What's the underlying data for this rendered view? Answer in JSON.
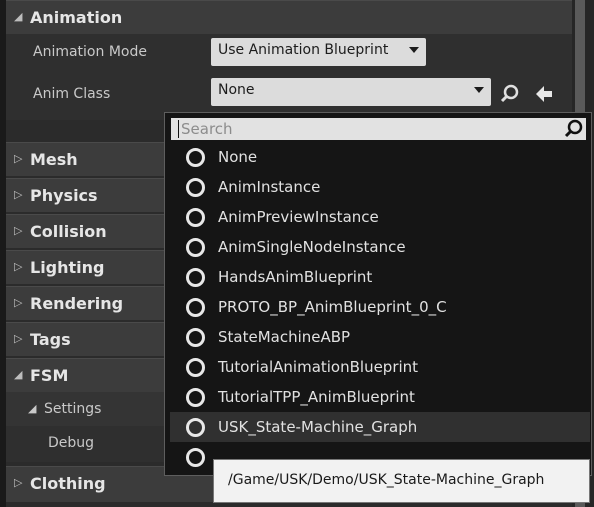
{
  "animation": {
    "header": "Animation",
    "mode_label": "Animation Mode",
    "mode_value": "Use Animation Blueprint",
    "class_label": "Anim Class",
    "class_value": "None"
  },
  "categories": [
    "Mesh",
    "Physics",
    "Collision",
    "Lighting",
    "Rendering",
    "Tags",
    "FSM",
    "Clothing"
  ],
  "fsm": {
    "settings": "Settings",
    "debug": "Debug"
  },
  "picker": {
    "search_placeholder": "Search",
    "items": [
      "None",
      "AnimInstance",
      "AnimPreviewInstance",
      "AnimSingleNodeInstance",
      "HandsAnimBlueprint",
      "PROTO_BP_AnimBlueprint_0_C",
      "StateMachineABP",
      "TutorialAnimationBlueprint",
      "TutorialTPP_AnimBlueprint",
      "USK_State-Machine_Graph"
    ],
    "selected": "USK_State-Machine_Graph"
  },
  "tooltip": "/Game/USK/Demo/USK_State-Machine_Graph",
  "icons": {
    "expanded": "triangle-down-icon",
    "collapsed": "triangle-right-icon",
    "browse": "magnifier-icon",
    "use_selected": "arrow-left-icon",
    "search": "magnifier-icon"
  }
}
